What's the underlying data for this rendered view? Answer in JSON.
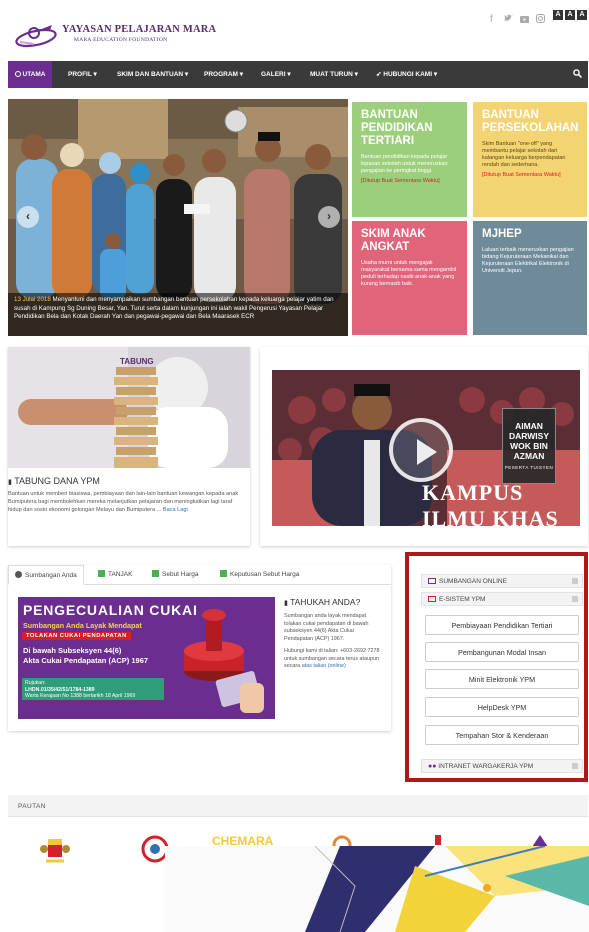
{
  "header": {
    "logo_title": "YAYASAN PELAJARAN MARA",
    "logo_subtitle": "MARA EDUCATION FOUNDATION",
    "social_icons": [
      "facebook-icon",
      "twitter-icon",
      "youtube-icon",
      "instagram-icon"
    ],
    "font_size_buttons": [
      "A",
      "A",
      "A"
    ]
  },
  "nav": {
    "items": [
      "UTAMA",
      "PROFIL",
      "SKIM DAN BANTUAN",
      "PROGRAM",
      "GALERI",
      "MUAT TURUN",
      "HUBUNGI KAMI"
    ]
  },
  "hero": {
    "date": "13 Julai 2018",
    "caption": "Menyantuni dan menyampaikan sumbangan bantuan persekolahan kepada keluarga pelajar yatim dan susah di Kampung Sg Duning Besar, Yan. Turut serta dalam kunjungan ini ialah wakil Pengerusi Yayasan Pelajar Pendidikan Bela dan Kotak Daerah Yan dan pegawai-pegawai dan Bela Maarasek ECR"
  },
  "tiles": [
    {
      "title": "BANTUAN PENDIDIKAN TERTIARI",
      "desc": "Bantuan pendidikan kepada pelajar lepasan sekolah untuk meneruskan pengajian ke peringkat tinggi.",
      "note": "[Ditutup Buat Sementara Waktu]",
      "color": "#9ccf7b"
    },
    {
      "title": "BANTUAN PERSEKOLAHAN",
      "desc": "Skim Bantuan \"one-off\" yang membantu pelajar sekolah dari kalangan keluarga berpendapatan rendah dan sederhana.",
      "note": "[Ditutup Buat Sementara Waktu]",
      "color": "#f3d372"
    },
    {
      "title": "SKIM ANAK ANGKAT",
      "desc": "Usaha murni untuk mengajak masyarakat bersama-sama mengambil peduli terhadap nasib anak-anak yang kurang bernasib baik.",
      "note": "",
      "color": "#e0657a"
    },
    {
      "title": "MJHEP",
      "desc": "Laluan terbaik meneruskan pengajian bidang Kejuruteraan Mekanikal dan Kejuruteraan Elektrikal Elektronik di Universiti Jepun.",
      "note": "",
      "color": "#6f8a99"
    }
  ],
  "tabung": {
    "title": "TABUNG DANA YPM",
    "desc": "Bantuan untuk memberi biasiswa, pembiayaan dan lain-lain bantuan kewangan kepada anak Bumiputera bagi membolehkan mereka melanjutkan pelajaran dan meningkatkan lagi taraf hidup dan sosio ekonomi golongan Melayu dan Bumiputera ...",
    "more": "Baca Lagi",
    "photo_text": "TABUNG"
  },
  "video": {
    "name": "AIMAN DARWISY WOK BIN AZMAN",
    "role": "PESERTA TUISYEN",
    "caption": "KAMPUS ILMU KHAS"
  },
  "tabs": [
    {
      "label": "Sumbangan Anda",
      "icon": "globe-icon"
    },
    {
      "label": "TANJAK",
      "icon": "list-icon"
    },
    {
      "label": "Sebut Harga",
      "icon": "document-icon"
    },
    {
      "label": "Keputusan Sebut Harga",
      "icon": "document-icon"
    }
  ],
  "banner": {
    "title": "PENGECUALIAN CUKAI",
    "subtitle": "Sumbangan Anda Layak Mendapat",
    "red_label": "TOLAKAN CUKAI PENDAPATAN",
    "line1": "Di bawah Subseksyen 44(6)",
    "line2": "Akta Cukai Pendapatan (ACP) 1967",
    "ref1": "Rujukan:",
    "ref2": "LHDN.01/35/42/51/1784-1389",
    "ref3": "Warta Kerajaan No 1388 bertarikh 18 April 1969"
  },
  "tahukah": {
    "title": "TAHUKAH ANDA?",
    "text1": "Sumbangan anda layak mendapat tolakan cukai pendapatan di bawah subseksyen 44(6) Akta Cukai Pendapatan (ACP) 1967.",
    "text2": "Hubungi kami di talian: +603-2692 7278 untuk sumbangan secara terus ataupun secara",
    "link": "atas talian (online)"
  },
  "esistem": {
    "sumbangan_online": "SUMBANGAN ONLINE",
    "title": "E-SISTEM YPM",
    "buttons": [
      "Pembiayaan Pendidikan Tertiari",
      "Pembangunan Modal Insan",
      "Minit Elektronik YPM",
      "HelpDesk YPM",
      "Tempahan Stor & Kenderaan"
    ],
    "intranet": "INTRANET WARGAKERJA YPM"
  },
  "pautan": {
    "label": "PAUTAN",
    "partner_text": "CHEMARA"
  },
  "colors": {
    "brand_purple": "#6b2d8e",
    "nav_dark": "#3a3a3a",
    "highlight_red": "#b2151a"
  }
}
